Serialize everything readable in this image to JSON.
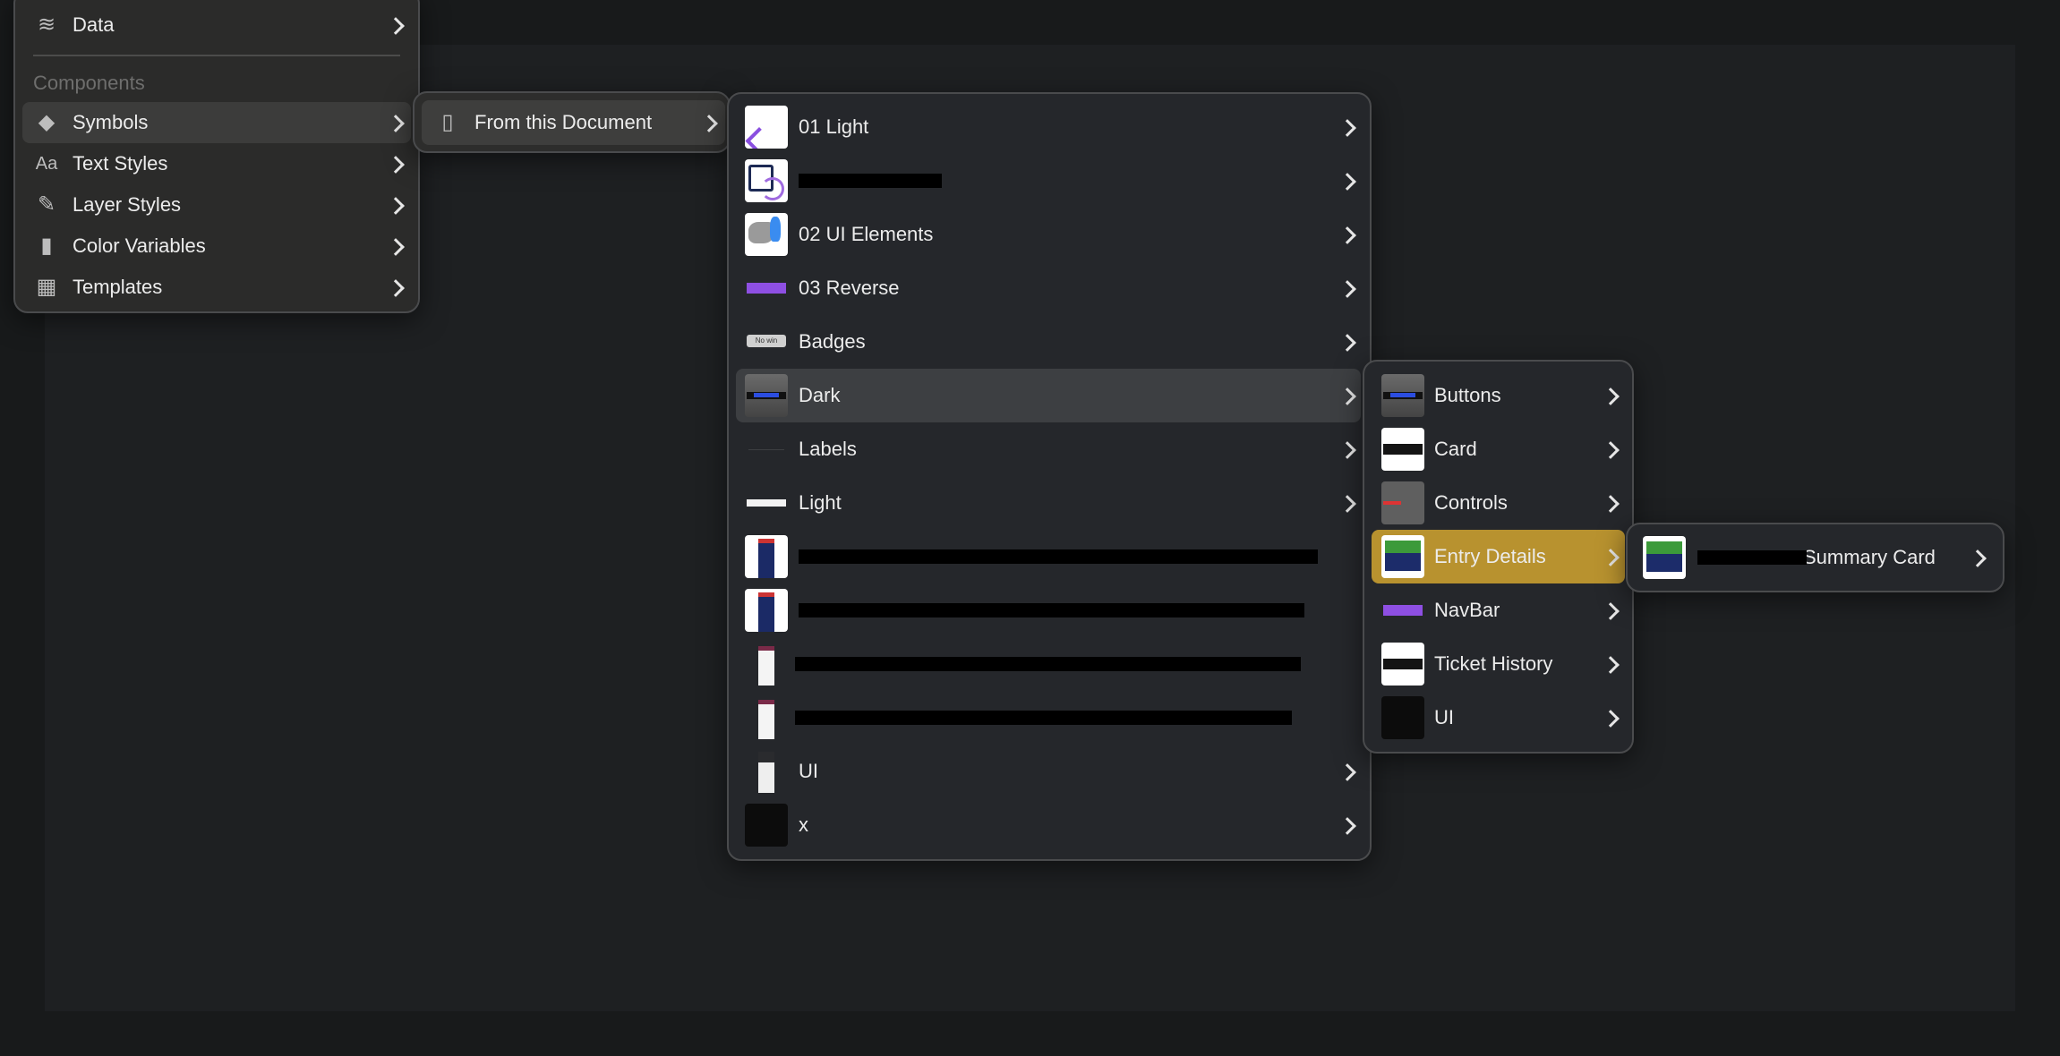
{
  "main_menu": {
    "items": [
      {
        "label": "Data",
        "icon": "layers-icon"
      },
      {
        "label": "Symbols",
        "icon": "symbol-diamond-icon",
        "highlighted": true
      },
      {
        "label": "Text Styles",
        "icon": "text-style-icon"
      },
      {
        "label": "Layer Styles",
        "icon": "brush-icon"
      },
      {
        "label": "Color Variables",
        "icon": "color-swatch-icon"
      },
      {
        "label": "Templates",
        "icon": "template-easel-icon"
      }
    ],
    "section_label": "Components"
  },
  "source_menu": {
    "items": [
      {
        "label": "From this Document",
        "icon": "document-icon",
        "highlighted": true
      }
    ]
  },
  "pages_menu": {
    "items": [
      {
        "label": "01 Light",
        "thumb": "back-chevron",
        "has_submenu": true
      },
      {
        "label": "",
        "thumb": "calendar-sync",
        "redacted": true,
        "has_submenu": true
      },
      {
        "label": "02 UI Elements",
        "thumb": "australia-map",
        "has_submenu": true
      },
      {
        "label": "03 Reverse",
        "thumb": "purple-bar",
        "has_submenu": true
      },
      {
        "label": "Badges",
        "thumb": "badge",
        "badge_text": "No win",
        "has_submenu": true
      },
      {
        "label": "Dark",
        "thumb": "dark-button",
        "highlighted": true,
        "has_submenu": true
      },
      {
        "label": "Labels",
        "thumb": "faint-line",
        "has_submenu": true
      },
      {
        "label": "Light",
        "thumb": "white-bar",
        "has_submenu": true
      },
      {
        "label": "",
        "thumb": "phone-blue",
        "redacted": true,
        "has_submenu": false
      },
      {
        "label": "",
        "thumb": "phone-blue",
        "redacted": true,
        "has_submenu": false
      },
      {
        "label": "",
        "thumb": "phone-maroon",
        "redacted": true,
        "has_submenu": false
      },
      {
        "label": "",
        "thumb": "phone-maroon",
        "redacted": true,
        "has_submenu": false
      },
      {
        "label": "UI",
        "thumb": "phone-ui",
        "has_submenu": true
      },
      {
        "label": "x",
        "thumb": "black",
        "has_submenu": true
      }
    ]
  },
  "dark_menu": {
    "items": [
      {
        "label": "Buttons",
        "thumb": "dark-button"
      },
      {
        "label": "Card",
        "thumb": "card"
      },
      {
        "label": "Controls",
        "thumb": "controls"
      },
      {
        "label": "Entry Details",
        "thumb": "entry-card",
        "highlighted": true
      },
      {
        "label": "NavBar",
        "thumb": "purple-bar"
      },
      {
        "label": "Ticket History",
        "thumb": "card"
      },
      {
        "label": "UI",
        "thumb": "black"
      }
    ]
  },
  "entry_menu": {
    "items": [
      {
        "label": "Summary Card",
        "thumb": "entry-card",
        "partially_redacted": true
      }
    ]
  },
  "colors": {
    "accent_highlight": "#b8922f",
    "menu_bg": "#25272b",
    "hover_bg": "#3d3f42"
  }
}
